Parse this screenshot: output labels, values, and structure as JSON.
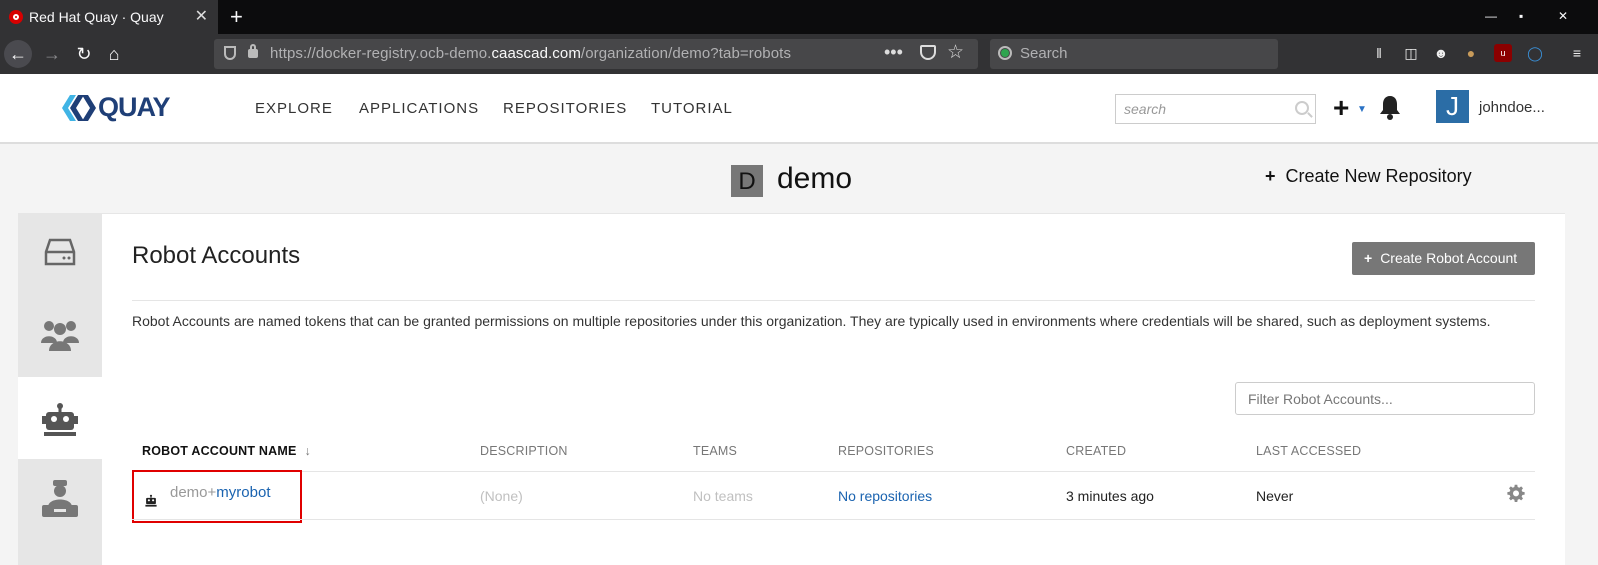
{
  "browser": {
    "tab_title": "Red Hat Quay · Quay",
    "tab_close": "✕",
    "new_tab": "+",
    "url_prefix": "https://docker-registry.ocb-demo.",
    "url_domain": "caascad.com",
    "url_suffix": "/organization/demo?tab=robots",
    "url_more": "•••",
    "search_placeholder": "Search",
    "window_controls": [
      "—",
      "▪",
      "✕"
    ]
  },
  "header": {
    "logo_text": "QUAY",
    "nav": [
      "EXPLORE",
      "APPLICATIONS",
      "REPOSITORIES",
      "TUTORIAL"
    ],
    "search_placeholder": "search",
    "avatar_letter": "J",
    "username": "johndoe..."
  },
  "org": {
    "avatar_letter": "D",
    "name": "demo",
    "create_repo_label": "Create New Repository"
  },
  "robots": {
    "title": "Robot Accounts",
    "create_button": "Create Robot Account",
    "description": "Robot Accounts are named tokens that can be granted permissions on multiple repositories under this organization. They are typically used in environments where credentials will be shared, such as deployment systems.",
    "filter_placeholder": "Filter Robot Accounts...",
    "columns": {
      "name": "ROBOT ACCOUNT NAME",
      "description": "DESCRIPTION",
      "teams": "TEAMS",
      "repositories": "REPOSITORIES",
      "created": "CREATED",
      "last_accessed": "LAST ACCESSED"
    },
    "rows": [
      {
        "prefix": "demo+",
        "shortname": "myrobot",
        "description": "(None)",
        "teams": "No teams",
        "repositories": "No repositories",
        "created": "3 minutes ago",
        "last_accessed": "Never"
      }
    ]
  },
  "icons": {
    "sidebar": [
      "repository-icon",
      "teams-icon",
      "robot-icon",
      "default-permissions-icon"
    ],
    "row_action": "gear-icon"
  },
  "colors": {
    "link": "#1a63b0",
    "button_gray": "#777777",
    "highlight_red": "#e00000",
    "logo_blue": "#1f3f77"
  }
}
